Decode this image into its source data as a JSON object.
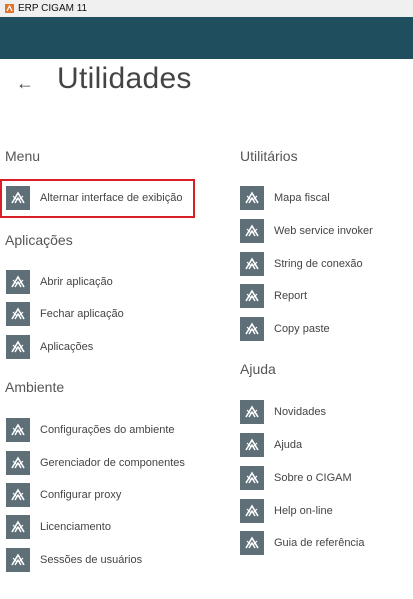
{
  "window": {
    "title": "ERP CIGAM 11"
  },
  "page": {
    "title": "Utilidades"
  },
  "colors": {
    "header": "#1f4e5f",
    "tile": "#5e6f78",
    "highlight": "#d91f25"
  },
  "icon": "app-shortcut-icon",
  "sections": {
    "menu": {
      "title": "Menu",
      "items": [
        "Alternar interface de exibição"
      ]
    },
    "aplicacoes": {
      "title": "Aplicações",
      "items": [
        "Abrir aplicação",
        "Fechar aplicação",
        "Aplicações"
      ]
    },
    "ambiente": {
      "title": "Ambiente",
      "items": [
        "Configurações do ambiente",
        "Gerenciador de componentes",
        "Configurar proxy",
        "Licenciamento",
        "Sessões de usuários"
      ]
    },
    "utilitarios": {
      "title": "Utilitários",
      "items": [
        "Mapa fiscal",
        "Web service invoker",
        "String de conexão",
        "Report",
        "Copy paste"
      ]
    },
    "ajuda": {
      "title": "Ajuda",
      "items": [
        "Novidades",
        "Ajuda",
        "Sobre o CIGAM",
        "Help on-line",
        "Guia de referência"
      ]
    }
  }
}
